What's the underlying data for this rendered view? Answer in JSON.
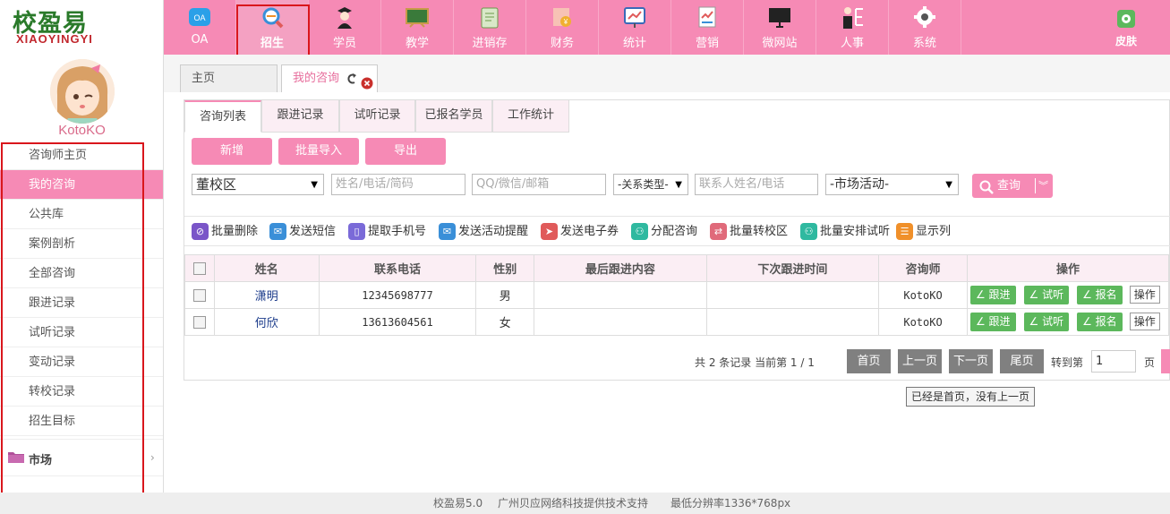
{
  "brand": {
    "logo_cn": "校盈易",
    "logo_en": "XIAOYINGYI",
    "username": "KotoKO"
  },
  "top_nav": [
    {
      "label": "OA",
      "icon": "oa-icon"
    },
    {
      "label": "招生",
      "icon": "enroll-search-icon",
      "active": true
    },
    {
      "label": "学员",
      "icon": "student-graduate-icon"
    },
    {
      "label": "教学",
      "icon": "blackboard-icon"
    },
    {
      "label": "进销存",
      "icon": "inventory-clipboard-icon"
    },
    {
      "label": "财务",
      "icon": "finance-coins-icon"
    },
    {
      "label": "统计",
      "icon": "stats-chart-icon"
    },
    {
      "label": "营销",
      "icon": "marketing-report-icon"
    },
    {
      "label": "微网站",
      "icon": "monitor-icon"
    },
    {
      "label": "人事",
      "icon": "personnel-icon"
    },
    {
      "label": "系统",
      "icon": "settings-gear-icon"
    }
  ],
  "skin": {
    "label": "皮肤",
    "icon": "skin-icon"
  },
  "side_nav": [
    {
      "label": "咨询师主页"
    },
    {
      "label": "我的咨询",
      "active": true
    },
    {
      "label": "公共库"
    },
    {
      "label": "案例剖析"
    },
    {
      "label": "全部咨询"
    },
    {
      "label": "跟进记录"
    },
    {
      "label": "试听记录"
    },
    {
      "label": "变动记录"
    },
    {
      "label": "转校记录"
    },
    {
      "label": "招生目标"
    }
  ],
  "side_group": {
    "label": "市场",
    "arrow": "›"
  },
  "page_tabs": {
    "home": "主页",
    "current": "我的咨询"
  },
  "sub_tabs": [
    "咨询列表",
    "跟进记录",
    "试听记录",
    "已报名学员",
    "工作统计"
  ],
  "action_buttons": {
    "add": "新增",
    "import": "批量导入",
    "export": "导出"
  },
  "filters": {
    "campus": "董校区",
    "name_placeholder": "姓名/电话/简码",
    "qq_placeholder": "QQ/微信/邮箱",
    "relation": "-关系类型-",
    "contact_placeholder": "联系人姓名/电话",
    "activity": "-市场活动-",
    "query_label": "查询"
  },
  "toolbar": [
    {
      "label": "批量删除",
      "color": "#7a55c8",
      "icon": "batch-delete-icon"
    },
    {
      "label": "发送短信",
      "color": "#3a8fd8",
      "icon": "sms-envelope-icon"
    },
    {
      "label": "提取手机号",
      "color": "#7a6ad8",
      "icon": "phone-icon"
    },
    {
      "label": "发送活动提醒",
      "color": "#3a8fd8",
      "icon": "reminder-envelope-icon"
    },
    {
      "label": "发送电子券",
      "color": "#e05a5a",
      "icon": "coupon-plane-icon"
    },
    {
      "label": "分配咨询",
      "color": "#2fb9a0",
      "icon": "assign-user-icon"
    },
    {
      "label": "批量转校区",
      "color": "#e06a7a",
      "icon": "transfer-campus-icon"
    },
    {
      "label": "批量安排试听",
      "color": "#2fb9a0",
      "icon": "schedule-trial-icon"
    },
    {
      "label": "显示列",
      "color": "#f0902a",
      "icon": "columns-list-icon"
    }
  ],
  "table": {
    "headers": [
      "姓名",
      "联系电话",
      "性别",
      "最后跟进内容",
      "下次跟进时间",
      "咨询师",
      "操作"
    ],
    "rows": [
      {
        "name": "潇明",
        "phone": "12345698777",
        "gender": "男",
        "last": "",
        "next": "",
        "counselor": "KotoKO"
      },
      {
        "name": "何欣",
        "phone": "13613604561",
        "gender": "女",
        "last": "",
        "next": "",
        "counselor": "KotoKO"
      }
    ],
    "row_actions": {
      "followup": "∠ 跟进",
      "trial": "∠ 试听",
      "signup": "∠ 报名",
      "more": "操作"
    }
  },
  "pager": {
    "info": "共 2 条记录 当前第 1 / 1",
    "first": "首页",
    "prev": "上一页",
    "next": "下一页",
    "last": "尾页",
    "jump_label": "转到第",
    "page_value": "1",
    "page_unit": "页"
  },
  "tooltip": "已经是首页，没有上一页",
  "footer": {
    "product": "校盈易5.0",
    "support": "广州贝应网络科技提供技术支持",
    "resolution": "最低分辨率1336*768px"
  },
  "colors": {
    "pink": "#f68ab5",
    "highlight_border": "#d9161c",
    "green_button": "#5cb85c",
    "pager_gray": "#808080"
  }
}
